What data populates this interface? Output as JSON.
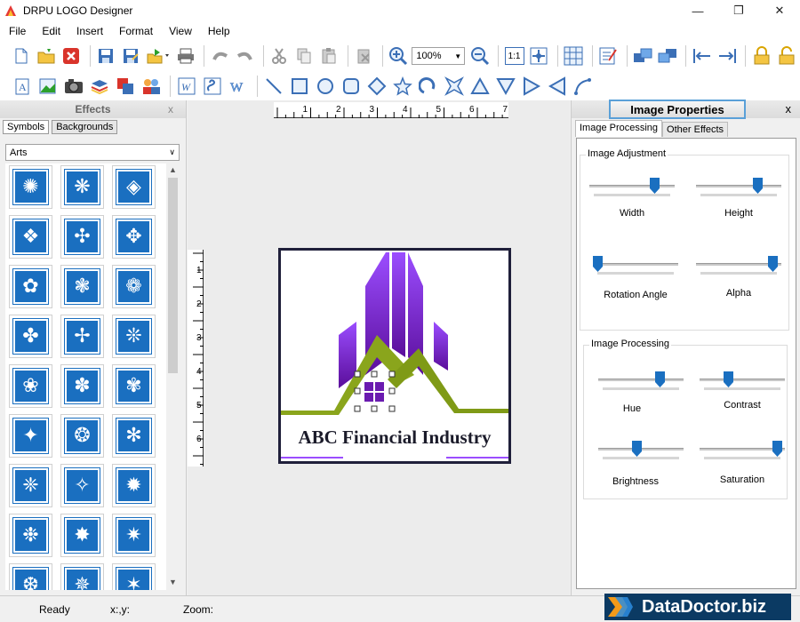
{
  "window": {
    "title": "DRPU LOGO Designer",
    "minimize": "—",
    "maximize": "❐",
    "close": "✕"
  },
  "menu": [
    "File",
    "Edit",
    "Insert",
    "Format",
    "View",
    "Help"
  ],
  "toolbar": {
    "zoom_value": "100%",
    "fit_label": "1:1"
  },
  "effects": {
    "title": "Effects",
    "close": "x",
    "tabs": [
      "Symbols",
      "Backgrounds"
    ],
    "category": "Arts",
    "symbol_count": 27
  },
  "canvas": {
    "ruler_h": [
      "1",
      "2",
      "3",
      "4",
      "5",
      "6",
      "7"
    ],
    "ruler_v": [
      "1",
      "2",
      "3",
      "4",
      "5",
      "6"
    ],
    "company_name": "ABC Financial Industry"
  },
  "properties": {
    "title": "Image Properties",
    "close": "x",
    "tabs": [
      "Image Processing",
      "Other Effects"
    ],
    "adjustment": {
      "label": "Image Adjustment",
      "sliders": [
        {
          "label": "Width",
          "value": 0.8
        },
        {
          "label": "Height",
          "value": 0.75
        },
        {
          "label": "Rotation Angle",
          "value": 0.0
        },
        {
          "label": "Alpha",
          "value": 0.95
        }
      ]
    },
    "processing": {
      "label": "Image Processing",
      "sliders": [
        {
          "label": "Hue",
          "value": 0.75
        },
        {
          "label": "Contrast",
          "value": 0.32
        },
        {
          "label": "Brightness",
          "value": 0.45
        },
        {
          "label": "Saturation",
          "value": 0.97
        }
      ]
    }
  },
  "status": {
    "ready": "Ready",
    "coords": "x:,y:",
    "zoom": "Zoom:"
  },
  "brand": {
    "text": "DataDoctor.biz"
  },
  "colors": {
    "accent_blue": "#1a6fc0",
    "purple": "#8a2be2",
    "green": "#8aa51c",
    "brand_bg": "#0b3a63"
  }
}
